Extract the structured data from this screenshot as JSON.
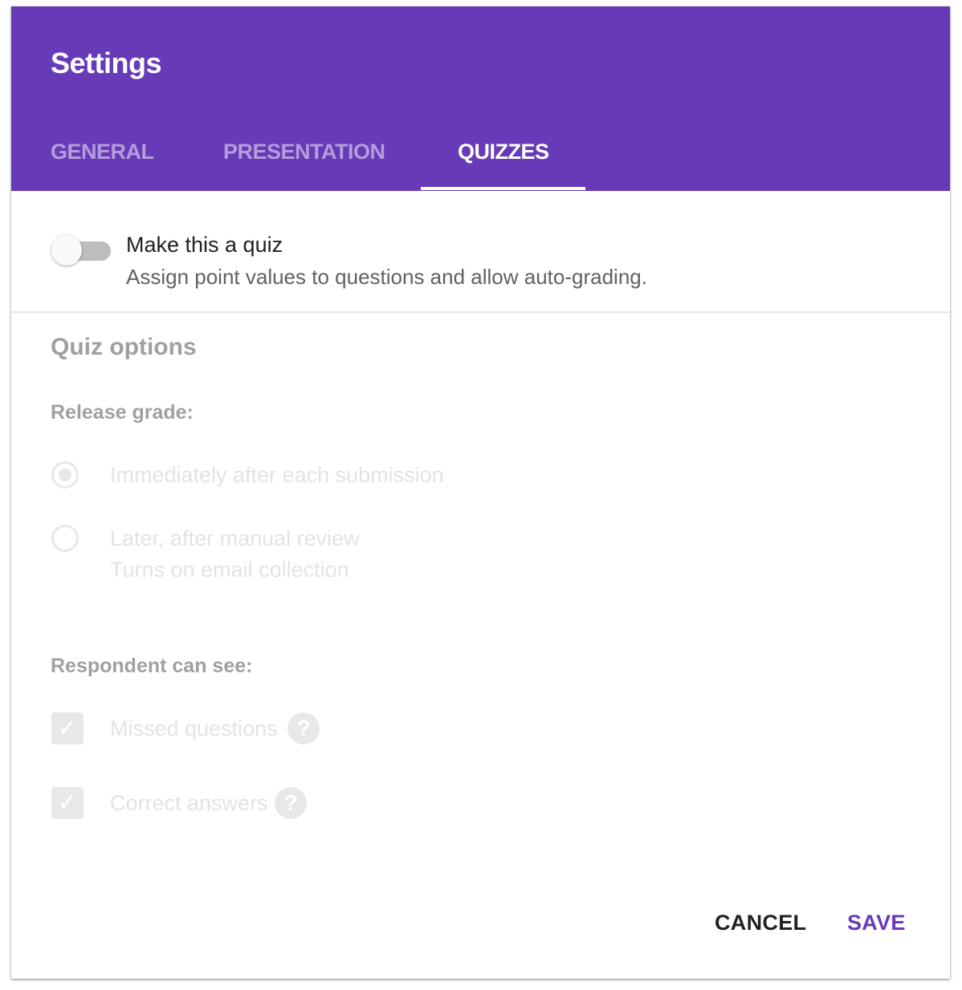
{
  "header": {
    "title": "Settings",
    "tabs": [
      {
        "label": "GENERAL"
      },
      {
        "label": "PRESENTATION"
      },
      {
        "label": "QUIZZES",
        "active": true
      }
    ],
    "color": "#673ab7"
  },
  "quiz_toggle": {
    "label": "Make this a quiz",
    "description": "Assign point values to questions and allow auto-grading.",
    "on": false
  },
  "quiz_options": {
    "title": "Quiz options",
    "release_grade": {
      "label": "Release grade:",
      "options": [
        {
          "label": "Immediately after each submission",
          "selected": true
        },
        {
          "label": "Later, after manual review",
          "hint": "Turns on email collection",
          "selected": false
        }
      ]
    },
    "respondent": {
      "label": "Respondent can see:",
      "items": [
        {
          "label": "Missed questions",
          "checked": true,
          "icon": "help-icon"
        },
        {
          "label": "Correct answers",
          "checked": true,
          "icon": "help-icon"
        }
      ]
    }
  },
  "footer": {
    "cancel": "CANCEL",
    "save": "SAVE",
    "save_color": "#673ab7"
  }
}
